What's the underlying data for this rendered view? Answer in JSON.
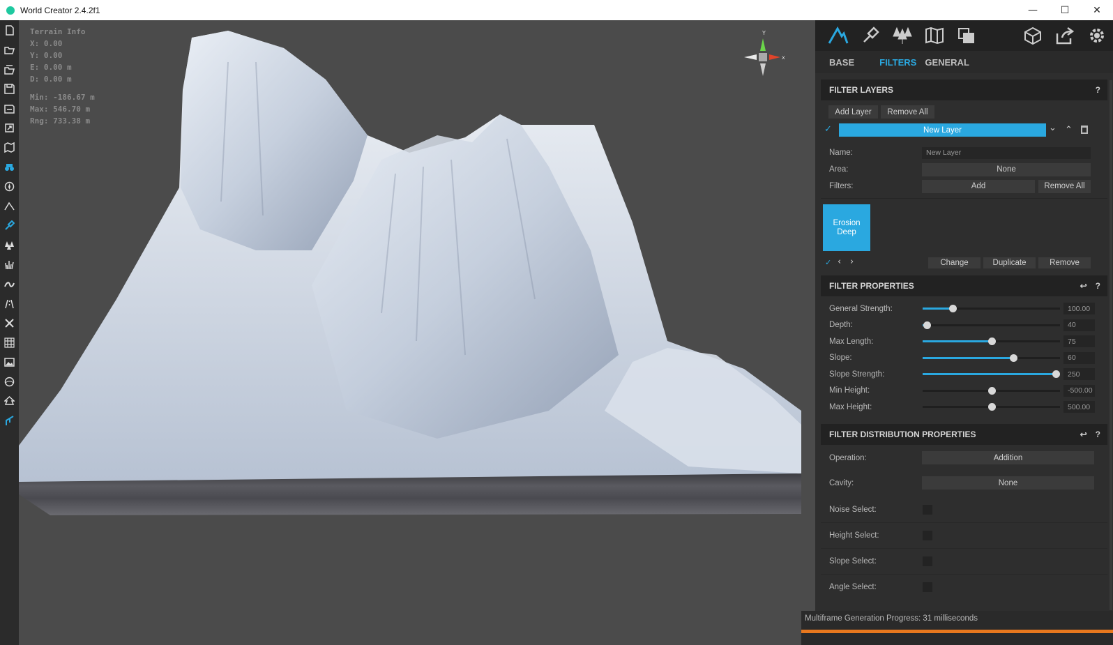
{
  "window": {
    "title": "World Creator 2.4.2f1",
    "minimize": "—",
    "maximize": "☐",
    "close": "✕"
  },
  "left_toolbar": {
    "icons": [
      "new-file-icon",
      "open-folder-icon",
      "open-recent-icon",
      "save-icon",
      "save-as-icon",
      "export-icon",
      "map-icon",
      "binoculars-icon",
      "navigation-icon",
      "terrain-icon",
      "brush-icon",
      "forest-icon",
      "grass-icon",
      "river-icon",
      "road-icon",
      "transform-icon",
      "grid-icon",
      "image-icon",
      "globe-icon",
      "tree-icon",
      "sculpt-icon"
    ],
    "active_index": 10
  },
  "terrain_info": {
    "title": "Terrain Info",
    "x": "X: 0.00",
    "y": "Y: 0.00",
    "e": "E: 0.00 m",
    "d": "D: 0.00 m",
    "min": "Min: -186.67 m",
    "max": "Max: 546.70 m",
    "rng": "Rng: 733.38 m"
  },
  "gizmo": {
    "y_label": "Y",
    "x_label": "x"
  },
  "panel": {
    "tabs": [
      "BASE",
      "FILTERS",
      "GENERAL"
    ],
    "active_tab": "FILTERS",
    "filter_layers": {
      "title": "FILTER LAYERS",
      "help": "?",
      "add_layer": "Add Layer",
      "remove_all": "Remove All",
      "layer_name": "New Layer",
      "name_label": "Name:",
      "name_value": "New Layer",
      "area_label": "Area:",
      "area_value": "None",
      "filters_label": "Filters:",
      "filters_add": "Add",
      "filters_remove_all": "Remove All",
      "tile_label": "Erosion Deep",
      "change": "Change",
      "duplicate": "Duplicate",
      "remove": "Remove"
    },
    "filter_properties": {
      "title": "FILTER PROPERTIES",
      "help": "?",
      "sliders": [
        {
          "label": "General Strength:",
          "value": "100.00",
          "fraction": 0.22
        },
        {
          "label": "Depth:",
          "value": "40",
          "fraction": 0.03
        },
        {
          "label": "Max Length:",
          "value": "75",
          "fraction": 0.5
        },
        {
          "label": "Slope:",
          "value": "60",
          "fraction": 0.66
        },
        {
          "label": "Slope Strength:",
          "value": "250",
          "fraction": 0.97
        },
        {
          "label": "Min Height:",
          "value": "-500.00",
          "fraction": 0.5,
          "nofill": true
        },
        {
          "label": "Max Height:",
          "value": "500.00",
          "fraction": 0.5,
          "nofill": true
        }
      ]
    },
    "distribution": {
      "title": "FILTER DISTRIBUTION PROPERTIES",
      "help": "?",
      "operation_label": "Operation:",
      "operation_value": "Addition",
      "cavity_label": "Cavity:",
      "cavity_value": "None",
      "noise_select": "Noise Select:",
      "height_select": "Height Select:",
      "slope_select": "Slope Select:",
      "angle_select": "Angle Select:"
    }
  },
  "status": {
    "text": "Multiframe Generation Progress: 31 milliseconds",
    "progress_fraction": 1.0
  },
  "colors": {
    "accent": "#2aa8e0",
    "progress": "#e8781e"
  }
}
